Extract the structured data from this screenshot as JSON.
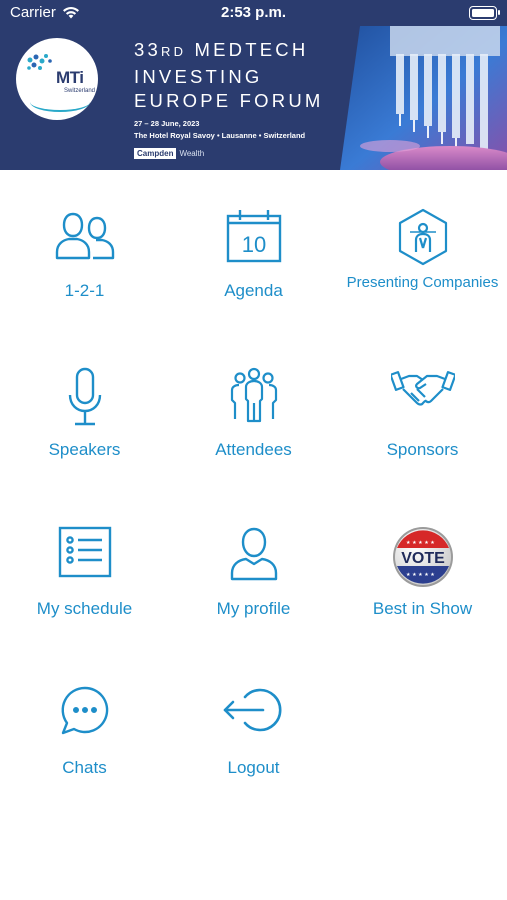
{
  "status_bar": {
    "carrier": "Carrier",
    "time": "2:53 p.m.",
    "battery_level": 1.0
  },
  "banner": {
    "logo_text": "MTi",
    "logo_subtitle": "Switzerland",
    "title_prefix": "33",
    "title_ordinal": "RD",
    "title_line1_rest": " MEDTECH",
    "title_line2": "INVESTING",
    "title_line3": "EUROPE FORUM",
    "date": "27 – 28 June, 2023",
    "venue": "The Hotel Royal Savoy • Lausanne • Switzerland",
    "sponsor_tag": "Campden",
    "sponsor_rest": "Wealth"
  },
  "accent_color": "#1e8ec9",
  "menu": [
    {
      "label": "1-2-1",
      "icon": "people-pair-icon"
    },
    {
      "label": "Agenda",
      "icon": "calendar-icon",
      "calendar_day": "10"
    },
    {
      "label": "Presenting Companies",
      "icon": "presenter-hexagon-icon"
    },
    {
      "label": "Speakers",
      "icon": "microphone-icon"
    },
    {
      "label": "Attendees",
      "icon": "group-icon"
    },
    {
      "label": "Sponsors",
      "icon": "handshake-icon"
    },
    {
      "label": "My schedule",
      "icon": "list-icon"
    },
    {
      "label": "My profile",
      "icon": "user-icon"
    },
    {
      "label": "Best in Show",
      "icon": "vote-badge-icon",
      "badge_text": "VOTE"
    },
    {
      "label": "Chats",
      "icon": "chat-bubble-icon"
    },
    {
      "label": "Logout",
      "icon": "logout-icon"
    }
  ]
}
